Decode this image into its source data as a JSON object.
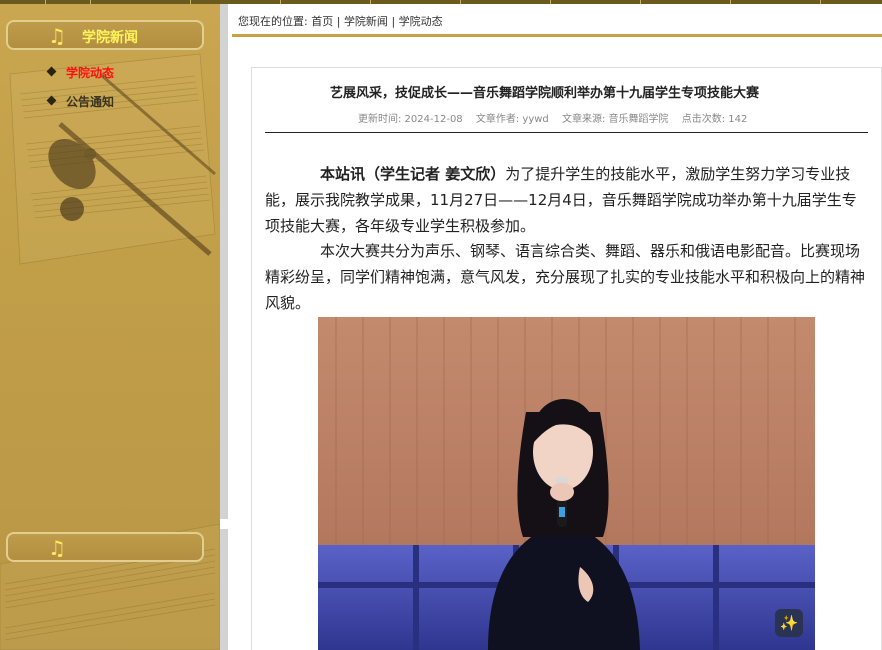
{
  "sidebar": {
    "header_title": "学院新闻",
    "note_icon": "♫",
    "menu": [
      {
        "label": "学院动态",
        "active": true
      },
      {
        "label": "公告通知",
        "active": false
      }
    ],
    "bottom_note_icon": "♫"
  },
  "breadcrumb": {
    "prefix": "您现在的位置:",
    "home": "首页",
    "sep": "|",
    "section": "学院新闻",
    "current": "学院动态"
  },
  "article": {
    "title": "艺展风采，技促成长——音乐舞蹈学院顺利举办第十九届学生专项技能大赛",
    "meta": {
      "updated": "更新时间:  2024-12-08",
      "author": "文章作者:  yywd",
      "source": "文章来源:  音乐舞蹈学院",
      "views": "点击次数:    142"
    },
    "p1_lead": "本站讯（学生记者  姜文欣）",
    "p1_text": "为了提升学生的技能水平，激励学生努力学习专业技能，展示我院教学成果，11月27日——12月4日，音乐舞蹈学院成功举办第十九届学生专项技能大赛，各年级专业学生积极参加。",
    "p2_text": "本次大赛共分为声乐、钢琴、语言综合类、舞蹈、器乐和俄语电影配音。比赛现场精彩纷呈，同学们精神饱满，意气风发，充分展现了扎实的专业技能水平和积极向上的精神风貌。"
  },
  "magic_icon": "✨"
}
